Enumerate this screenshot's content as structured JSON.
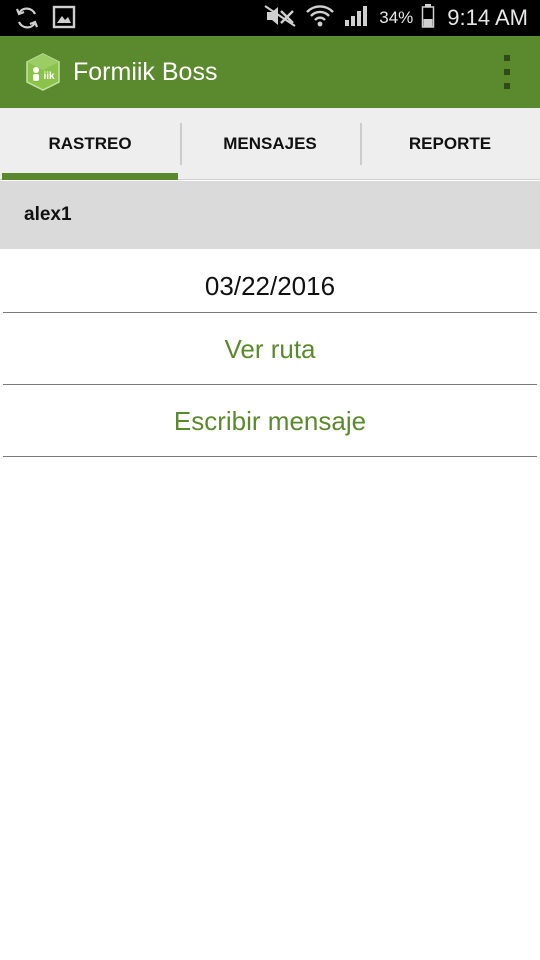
{
  "status_bar": {
    "icons": [
      "sync-icon",
      "image-icon",
      "mute-icon",
      "wifi-icon",
      "signal-icon",
      "battery-icon"
    ],
    "battery": "34%",
    "time": "9:14 AM"
  },
  "app_bar": {
    "title": "Formiik Boss",
    "logo_icon": "formiik-logo-icon",
    "menu_icon": "overflow-menu-icon",
    "color": "#5b8a2e"
  },
  "tabs": [
    {
      "label": "RASTREO",
      "active": true
    },
    {
      "label": "MENSAJES",
      "active": false
    },
    {
      "label": "REPORTE",
      "active": false
    }
  ],
  "user": {
    "name": "alex1"
  },
  "content": {
    "date": "03/22/2016",
    "route_link": "Ver ruta",
    "message_link": "Escribir mensaje"
  }
}
